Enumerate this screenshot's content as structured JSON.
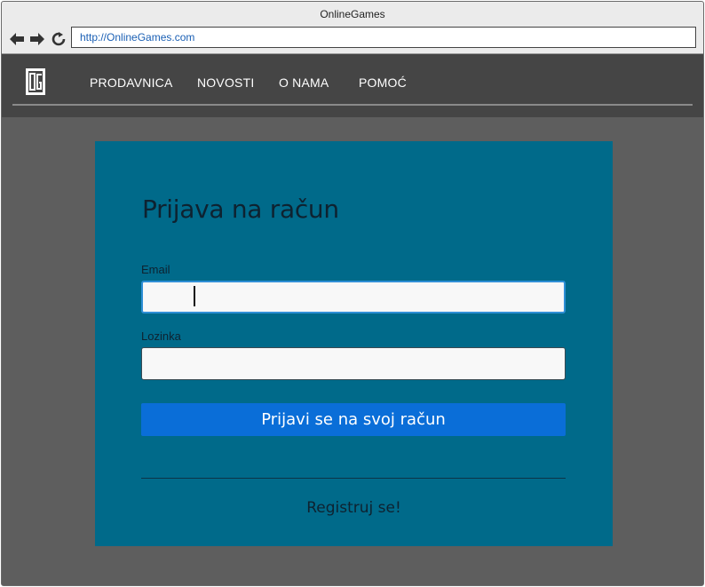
{
  "browser": {
    "title": "OnlineGames",
    "url": "http://OnlineGames.com",
    "back_icon": "arrow-left-icon",
    "forward_icon": "arrow-right-icon",
    "reload_icon": "reload-icon"
  },
  "site": {
    "logo_icon": "og-logo-icon",
    "nav": [
      {
        "label": "PRODAVNICA"
      },
      {
        "label": "NOVOSTI"
      },
      {
        "label": "O NAMA"
      },
      {
        "label": "POMOĆ"
      }
    ]
  },
  "login": {
    "title": "Prijava na račun",
    "email_label": "Email",
    "email_value": "",
    "password_label": "Lozinka",
    "password_value": "",
    "submit_label": "Prijavi se na svoj račun",
    "register_label": "Registruj se!"
  },
  "colors": {
    "nav_bar": "#454545",
    "page_background": "#5e5e5e",
    "card": "#006a8a",
    "primary_button": "#0a6ed8",
    "url_text": "#1a5fb4"
  }
}
